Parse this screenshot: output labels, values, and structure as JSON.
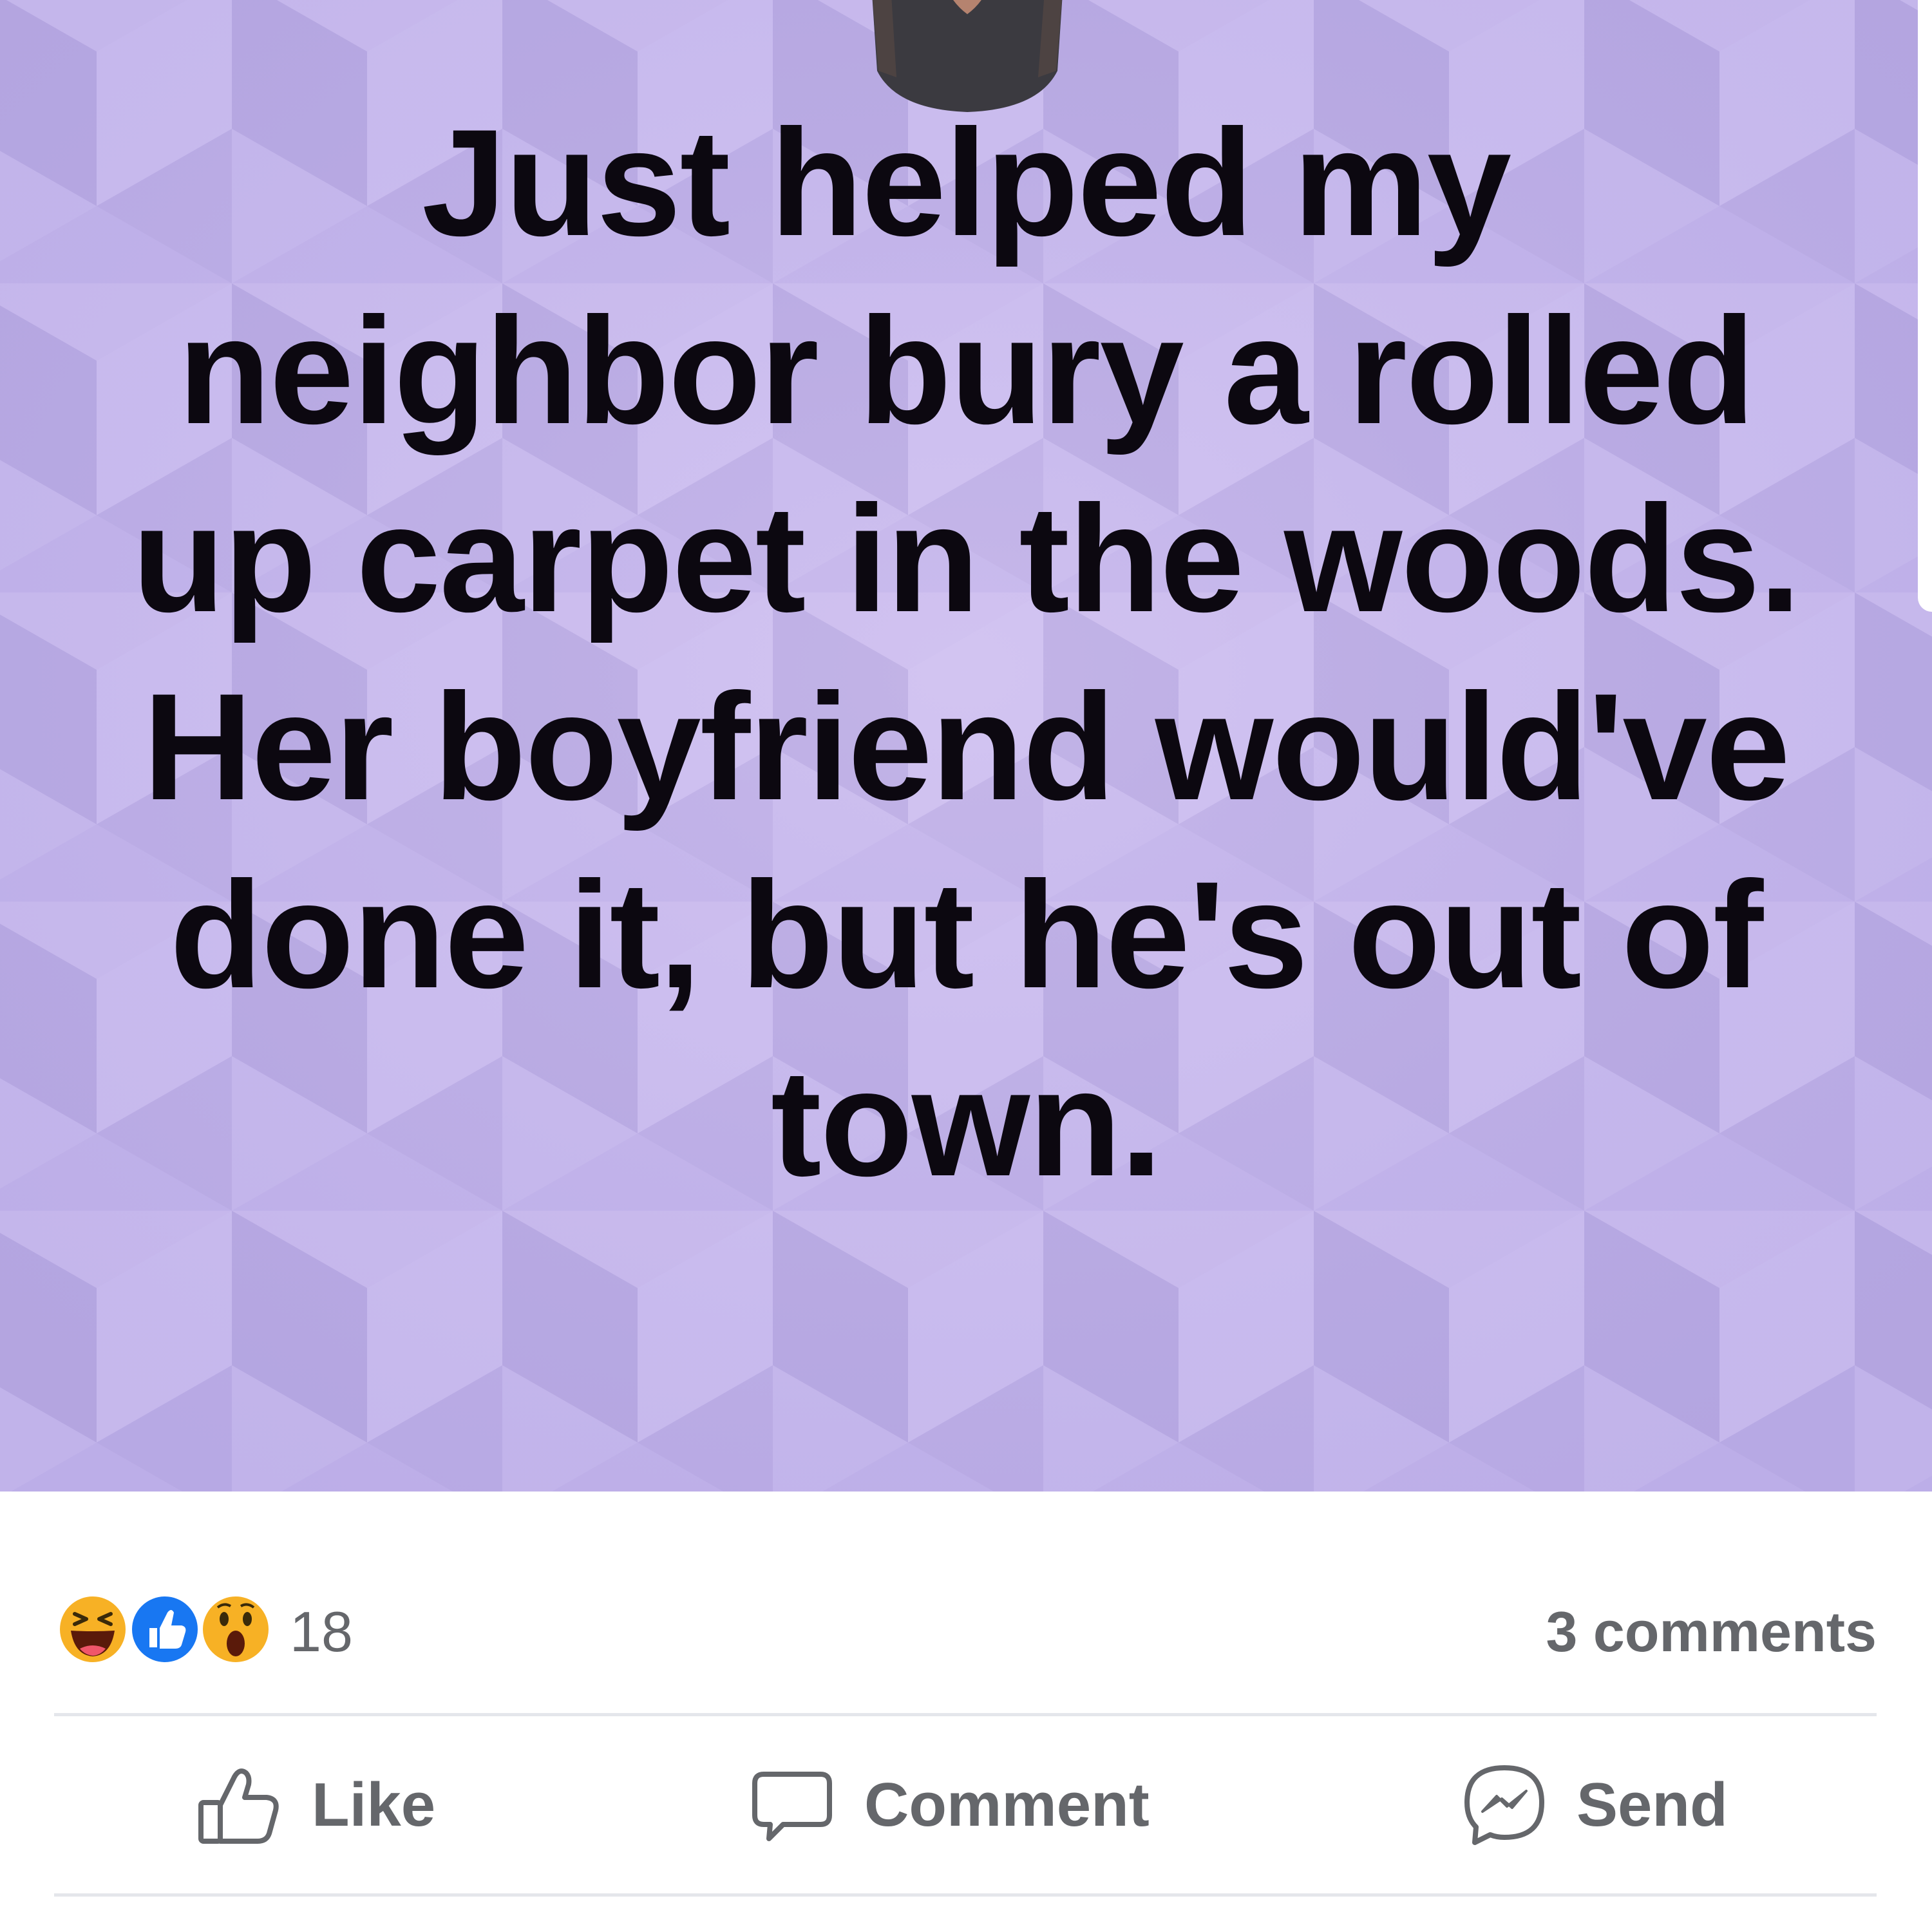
{
  "post": {
    "status_text": "Just helped my neighbor bury a rolled up carpet in the woods. Her boyfriend would've done it, but he's out of town.",
    "background_color": "#c2b4ec"
  },
  "reactions": {
    "icons": [
      "haha-reaction-icon",
      "like-reaction-icon",
      "wow-reaction-icon"
    ],
    "count": "18",
    "comments_label": "3 comments"
  },
  "actions": {
    "like_label": "Like",
    "comment_label": "Comment",
    "send_label": "Send"
  },
  "colors": {
    "secondary_text": "#65676b",
    "like_blue": "#1877f2",
    "reaction_yellow": "#f7b125",
    "divider": "#e4e6eb"
  }
}
